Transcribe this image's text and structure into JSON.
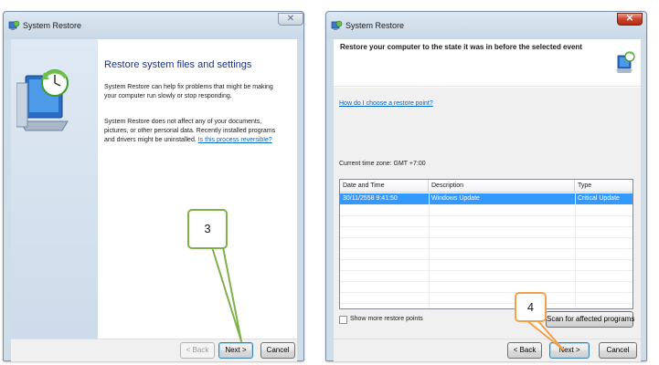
{
  "left_window": {
    "title": "System Restore",
    "close_glyph": "✕",
    "icon": "system-restore-icon",
    "hero_icon": "computer-restore-icon",
    "heading": "Restore system files and settings",
    "para1": "System Restore can help fix problems that might be making your computer run slowly or stop responding.",
    "para2": "System Restore does not affect any of your documents, pictures, or other personal data. Recently installed programs and drivers might be uninstalled.",
    "link": "Is this process reversible?",
    "back_label": "< Back",
    "next_label": "Next >",
    "cancel_label": "Cancel"
  },
  "right_window": {
    "title": "System Restore",
    "close_glyph": "✕",
    "icon": "system-restore-icon",
    "heading": "Restore your computer to the state it was in before the selected event",
    "link": "How do I choose a restore point?",
    "timezone": "Current time zone: GMT +7:00",
    "columns": [
      "Date and Time",
      "Description",
      "Type"
    ],
    "rows": [
      {
        "date": "30/11/2558 9:41:50",
        "description": "Windows Update",
        "type": "Critical Update"
      }
    ],
    "show_more_label": "Show more restore points",
    "show_more_checked": false,
    "scan_label": "Scan for affected programs",
    "back_label": "< Back",
    "next_label": "Next >",
    "cancel_label": "Cancel"
  },
  "callouts": {
    "step3": "3",
    "step4": "4"
  },
  "colors": {
    "selection": "#3399ff",
    "heading_blue": "#1e3287",
    "link_blue": "#0066cc",
    "callout3_border": "#7fb049",
    "callout4_border": "#f0a04b"
  }
}
